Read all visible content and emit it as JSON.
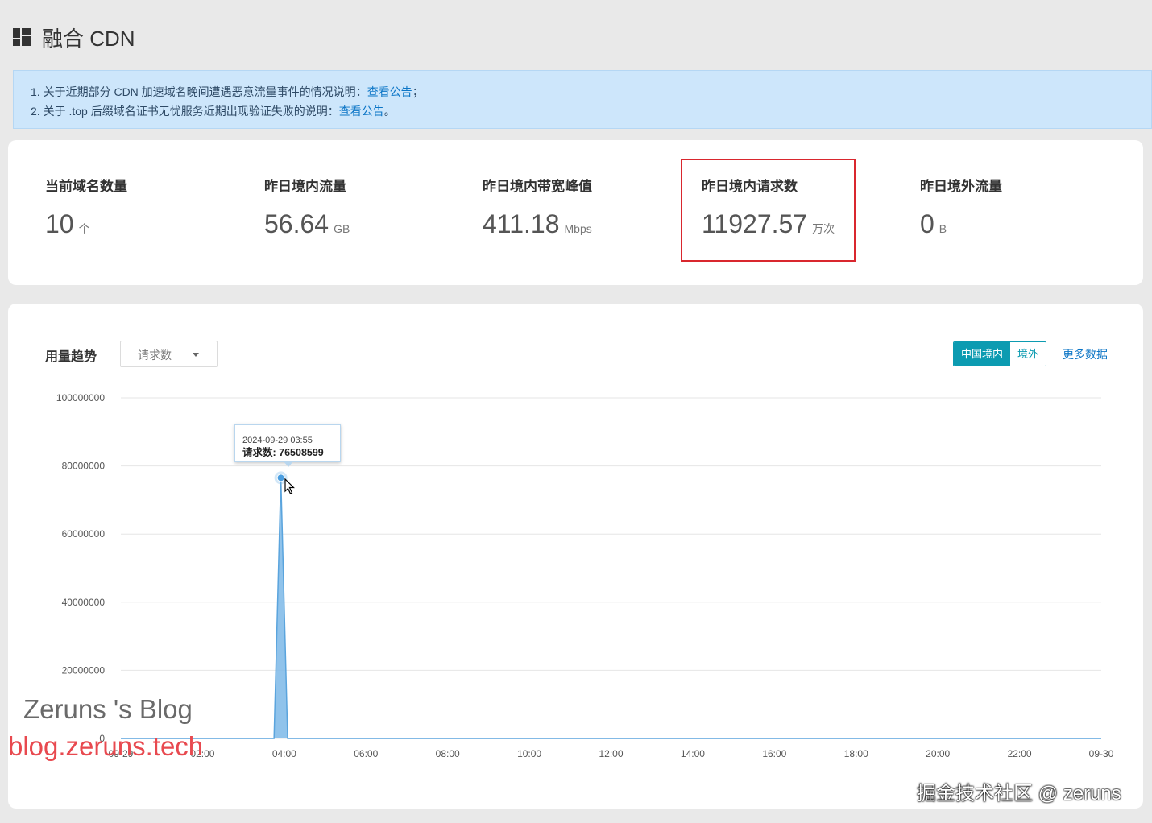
{
  "header": {
    "title": "融合 CDN"
  },
  "notices": [
    {
      "text": "1. 关于近期部分 CDN 加速域名晚间遭遇恶意流量事件的情况说明：",
      "link": "查看公告",
      "suffix": "；"
    },
    {
      "text": "2. 关于 .top 后缀域名证书无忧服务近期出现验证失败的说明：",
      "link": "查看公告",
      "suffix": "。"
    }
  ],
  "stats": [
    {
      "label": "当前域名数量",
      "value": "10",
      "unit": "个"
    },
    {
      "label": "昨日境内流量",
      "value": "56.64",
      "unit": "GB"
    },
    {
      "label": "昨日境内带宽峰值",
      "value": "411.18",
      "unit": "Mbps"
    },
    {
      "label": "昨日境内请求数",
      "value": "11927.57",
      "unit": "万次"
    },
    {
      "label": "昨日境外流量",
      "value": "0",
      "unit": "B"
    }
  ],
  "trend": {
    "title": "用量趋势",
    "metric_select": "请求数",
    "region_tabs": [
      "中国境内",
      "境外"
    ],
    "active_region": "中国境内",
    "more_link": "更多数据"
  },
  "colors": {
    "accent": "#0c9bb1",
    "link": "#0b75c6",
    "highlight": "#d9272e",
    "series": "#7db9e8"
  },
  "chart_data": {
    "type": "area",
    "x_ticks": [
      "09-29",
      "02:00",
      "04:00",
      "06:00",
      "08:00",
      "10:00",
      "12:00",
      "14:00",
      "16:00",
      "18:00",
      "20:00",
      "22:00",
      "09-30"
    ],
    "y_ticks": [
      "100000000",
      "80000000",
      "60000000",
      "40000000",
      "20000000",
      "0"
    ],
    "ylim": [
      0,
      100000000
    ],
    "series": [
      {
        "name": "请求数",
        "points": [
          [
            "09-29 00:00",
            0
          ],
          [
            "09-29 03:45",
            0
          ],
          [
            "09-29 03:55",
            76508599
          ],
          [
            "09-29 04:05",
            0
          ],
          [
            "09-30 00:00",
            0
          ]
        ]
      }
    ],
    "tooltip": {
      "time": "2024-09-29 03:55",
      "label": "请求数: 76508599"
    }
  },
  "watermarks": [
    "Zeruns 's Blog",
    "blog.zeruns.tech",
    "掘金技术社区 @ zeruns"
  ]
}
